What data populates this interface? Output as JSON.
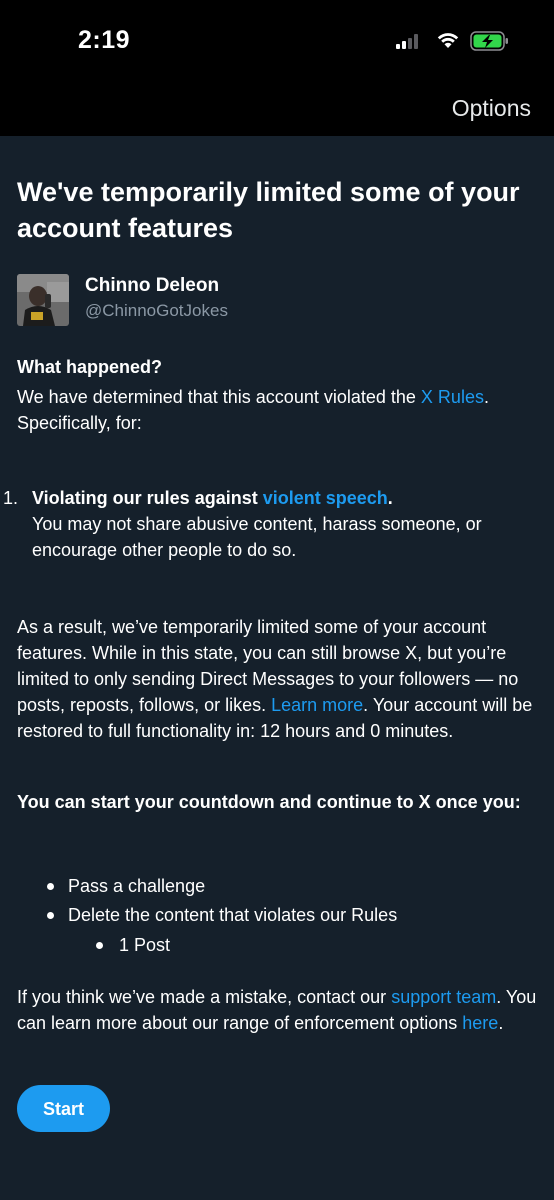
{
  "status_bar": {
    "time": "2:19"
  },
  "nav": {
    "options_label": "Options"
  },
  "page": {
    "title": "We've temporarily limited some of your account features"
  },
  "user": {
    "name": "Chinno Deleon",
    "handle": "@ChinnoGotJokes"
  },
  "what_happened": {
    "heading": "What happened?",
    "text_before_link": "We have determined that this account violated the ",
    "rules_link": "X Rules",
    "text_after_link": ". Specifically, for:"
  },
  "violation": {
    "number": "1.",
    "title_prefix": "Violating our rules against ",
    "title_link": "violent speech",
    "title_suffix": ".",
    "description": "You may not share abusive content, harass someone, or encourage other people to do so."
  },
  "result": {
    "text_before_link": "As a result, we’ve temporarily limited some of your account features. While in this state, you can still browse X, but you’re limited to only sending Direct Messages to your followers — no posts, reposts, follows, or likes. ",
    "learn_more_link": "Learn more",
    "text_after_link": ". Your account will be restored to full functionality in: 12 hours and 0 minutes."
  },
  "countdown": {
    "heading": "You can start your countdown and continue to X once you:",
    "items": [
      {
        "label": "Pass a challenge"
      },
      {
        "label": "Delete the content that violates our Rules"
      }
    ],
    "sub_items": [
      {
        "label": "1 Post"
      }
    ]
  },
  "mistake": {
    "text_before_link": "If you think we’ve made a mistake, contact our ",
    "support_link": "support team",
    "text_middle": ". You can learn more about our range of enforcement options ",
    "here_link": "here",
    "text_end": "."
  },
  "actions": {
    "start_label": "Start"
  },
  "colors": {
    "background": "#15202b",
    "status_bar": "#000000",
    "link": "#1d9bf0",
    "button": "#1d9bf0",
    "secondary_text": "#8b98a5"
  }
}
